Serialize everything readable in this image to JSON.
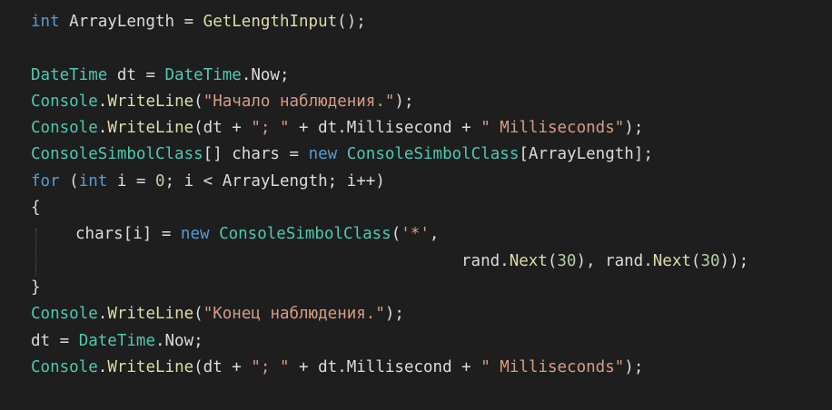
{
  "code": {
    "lines": [
      [
        {
          "c": "kw",
          "t": "int"
        },
        {
          "c": "id",
          "t": " ArrayLength = "
        },
        {
          "c": "mt",
          "t": "GetLengthInput"
        },
        {
          "c": "id",
          "t": "();"
        }
      ],
      [],
      [
        {
          "c": "ty",
          "t": "DateTime"
        },
        {
          "c": "id",
          "t": " dt = "
        },
        {
          "c": "ty",
          "t": "DateTime"
        },
        {
          "c": "id",
          "t": ".Now;"
        }
      ],
      [
        {
          "c": "ty",
          "t": "Console"
        },
        {
          "c": "id",
          "t": "."
        },
        {
          "c": "mt",
          "t": "WriteLine"
        },
        {
          "c": "id",
          "t": "("
        },
        {
          "c": "str",
          "t": "\"Начало наблюдения.\""
        },
        {
          "c": "id",
          "t": ");"
        }
      ],
      [
        {
          "c": "ty",
          "t": "Console"
        },
        {
          "c": "id",
          "t": "."
        },
        {
          "c": "mt",
          "t": "WriteLine"
        },
        {
          "c": "id",
          "t": "(dt + "
        },
        {
          "c": "str",
          "t": "\"; \""
        },
        {
          "c": "id",
          "t": " + dt.Millisecond + "
        },
        {
          "c": "str",
          "t": "\" Milliseconds\""
        },
        {
          "c": "id",
          "t": ");"
        }
      ],
      [
        {
          "c": "ty",
          "t": "ConsoleSimbolClass"
        },
        {
          "c": "id",
          "t": "[] chars = "
        },
        {
          "c": "kw",
          "t": "new"
        },
        {
          "c": "id",
          "t": " "
        },
        {
          "c": "ty",
          "t": "ConsoleSimbolClass"
        },
        {
          "c": "id",
          "t": "[ArrayLength];"
        }
      ],
      [
        {
          "c": "kw",
          "t": "for"
        },
        {
          "c": "id",
          "t": " ("
        },
        {
          "c": "kw",
          "t": "int"
        },
        {
          "c": "id",
          "t": " i = "
        },
        {
          "c": "num",
          "t": "0"
        },
        {
          "c": "id",
          "t": "; i < ArrayLength; i++)"
        }
      ],
      [
        {
          "c": "id",
          "t": "{"
        }
      ],
      [
        {
          "c": "id",
          "t": "chars[i] = "
        },
        {
          "c": "kw",
          "t": "new"
        },
        {
          "c": "id",
          "t": " "
        },
        {
          "c": "ty",
          "t": "ConsoleSimbolClass"
        },
        {
          "c": "id",
          "t": "("
        },
        {
          "c": "str",
          "t": "'*'"
        },
        {
          "c": "id",
          "t": ","
        }
      ],
      [
        {
          "c": "id",
          "t": "rand."
        },
        {
          "c": "mt",
          "t": "Next"
        },
        {
          "c": "id",
          "t": "("
        },
        {
          "c": "num",
          "t": "30"
        },
        {
          "c": "id",
          "t": "), rand."
        },
        {
          "c": "mt",
          "t": "Next"
        },
        {
          "c": "id",
          "t": "("
        },
        {
          "c": "num",
          "t": "30"
        },
        {
          "c": "id",
          "t": "));"
        }
      ],
      [
        {
          "c": "id",
          "t": "}"
        }
      ],
      [
        {
          "c": "ty",
          "t": "Console"
        },
        {
          "c": "id",
          "t": "."
        },
        {
          "c": "mt",
          "t": "WriteLine"
        },
        {
          "c": "id",
          "t": "("
        },
        {
          "c": "str",
          "t": "\"Конец наблюдения.\""
        },
        {
          "c": "id",
          "t": ");"
        }
      ],
      [
        {
          "c": "id",
          "t": "dt = "
        },
        {
          "c": "ty",
          "t": "DateTime"
        },
        {
          "c": "id",
          "t": ".Now;"
        }
      ],
      [
        {
          "c": "ty",
          "t": "Console"
        },
        {
          "c": "id",
          "t": "."
        },
        {
          "c": "mt",
          "t": "WriteLine"
        },
        {
          "c": "id",
          "t": "(dt + "
        },
        {
          "c": "str",
          "t": "\"; \""
        },
        {
          "c": "id",
          "t": " + dt.Millisecond + "
        },
        {
          "c": "str",
          "t": "\" Milliseconds\""
        },
        {
          "c": "id",
          "t": ");"
        }
      ]
    ]
  }
}
